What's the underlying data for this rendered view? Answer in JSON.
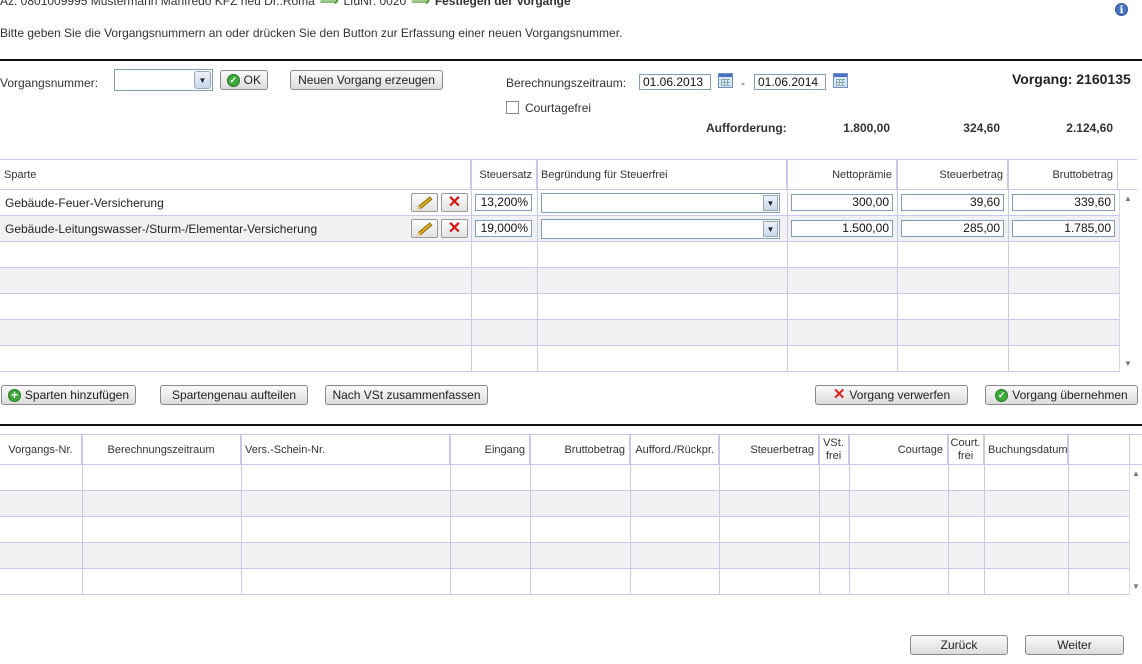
{
  "breadcrumb": {
    "part1": "Az. 0801009995 Mustermann Manfredo KFZ neu Dr..Roma",
    "part2": "LfdNr: 0020",
    "part3": "Festlegen der Vorgänge"
  },
  "intro": "Bitte geben Sie die Vorgangsnummern an oder drücken Sie den Button zur Erfassung einer neuen Vorgangsnummer.",
  "form": {
    "vorgangsnummer_label": "Vorgangsnummer:",
    "ok_label": "OK",
    "neuer_vorgang_label": "Neuen Vorgang erzeugen",
    "zeitraum_label": "Berechnungszeitraum:",
    "date_from": "01.06.2013",
    "date_sep": "-",
    "date_to": "01.06.2014",
    "courtagefrei_label": "Courtagefrei",
    "vorgang_title": "Vorgang: 2160135",
    "aufforderung_label": "Aufforderung:",
    "aufforderung_netto": "1.800,00",
    "aufforderung_steuer": "324,60",
    "aufforderung_brutto": "2.124,60"
  },
  "sparten_table": {
    "headers": {
      "sparte": "Sparte",
      "steuersatz": "Steuersatz",
      "begruendung": "Begründung für Steuerfrei",
      "netto": "Nettoprämie",
      "steuer": "Steuerbetrag",
      "brutto": "Bruttobetrag"
    },
    "rows": [
      {
        "sparte": "Gebäude-Feuer-Versicherung",
        "steuersatz": "13,200%",
        "netto": "300,00",
        "steuer": "39,60",
        "brutto": "339,60"
      },
      {
        "sparte": "Gebäude-Leitungswasser-/Sturm-/Elementar-Versicherung",
        "steuersatz": "19,000%",
        "netto": "1.500,00",
        "steuer": "285,00",
        "brutto": "1.785,00"
      }
    ]
  },
  "actions": {
    "sparten_hinzufuegen": "Sparten hinzufügen",
    "spartengenau": "Spartengenau aufteilen",
    "nach_vst": "Nach VSt zusammenfassen",
    "verwerfen": "Vorgang verwerfen",
    "uebernehmen": "Vorgang übernehmen"
  },
  "vorgaenge_table": {
    "headers": {
      "nr": "Vorgangs-Nr.",
      "zeitraum": "Berechnungszeitraum",
      "schein": "Vers.-Schein-Nr.",
      "eingang": "Eingang",
      "brutto": "Bruttobetrag",
      "auffordrueck": "Aufford./Rückpr.",
      "steuer": "Steuerbetrag",
      "vst_a": "VSt.",
      "vst_b": "frei",
      "courtage": "Courtage",
      "court_a": "Court.",
      "court_b": "frei",
      "buchung": "Buchungsdatum"
    }
  },
  "footer": {
    "zurueck": "Zurück",
    "weiter": "Weiter"
  },
  "icons": {
    "info": "i",
    "ok": "✓",
    "add": "+",
    "x": "✕",
    "dropdown": "▼",
    "scroll_up": "▲",
    "scroll_down": "▼"
  }
}
